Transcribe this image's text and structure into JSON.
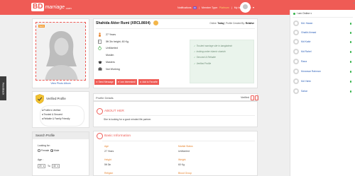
{
  "header": {
    "logo_main": "BD",
    "logo_script": "marriage",
    "logo_suffix": ".com",
    "notifications_label": "Notifications",
    "notifications_count": "16",
    "member_type_label": "Member Type:",
    "member_type_value": "Platinum",
    "separator": "|",
    "my_account": "My bdmarriage",
    "avatar_caret": "▾",
    "colors": {
      "brand": "#ef5b55",
      "badge": "#7b52c7",
      "platinum": "#f7d36a"
    }
  },
  "feedback_tab": "Feedback",
  "photo": {
    "ribbon": "NEW",
    "view_album": "View Photo Album"
  },
  "verified_profile": {
    "title": "Verified Profile",
    "items": [
      "Profile is Verified",
      "Trusted & Secured",
      "Reliable & Family Friendly"
    ]
  },
  "search": {
    "title": "Search Profile",
    "looking_for_label": "Looking for:",
    "options": [
      "Female",
      "Male"
    ],
    "selected_option": "Male",
    "age_label": "Age :",
    "age_from": "20",
    "age_to_label": "To",
    "age_to": "40"
  },
  "profile": {
    "name": "Shahida Akter Rumi (XRCL8604)",
    "online_prefix": "Online:",
    "online_value": "Today",
    "created_prefix": "| Profile Created By:",
    "created_value": "Relative",
    "attributes": [
      {
        "icon": "person-icon",
        "text": "27 Years"
      },
      {
        "icon": "height-icon",
        "text": "5ft 3in height, 60 Kg"
      },
      {
        "icon": "ring-icon",
        "text": "UnMarried"
      },
      {
        "icon": "religion-icon",
        "text": "Muslim"
      },
      {
        "icon": "graduation-icon",
        "text": "Masters"
      },
      {
        "icon": "briefcase-icon",
        "text": "Not Working"
      }
    ],
    "trust_points": [
      "Trusted marriage site in bangladesh",
      "looking under islamic shariah",
      "Secured & Reliable",
      "Verified Profile"
    ],
    "actions": [
      {
        "icon": "mail-icon",
        "label": "Send Message"
      },
      {
        "icon": "heart-icon",
        "label": "I am Interested!"
      },
      {
        "icon": "star-icon",
        "label": "Add to Favorite"
      }
    ]
  },
  "details": {
    "header": "Profile Details",
    "verified_label": "Verified",
    "about": {
      "title": "ABOUT HER",
      "text": "She is looking for a good minded life partner."
    },
    "basic": {
      "title": "Basic Information",
      "fields": [
        {
          "label": "Age",
          "value": "27 Years"
        },
        {
          "label": "Marital Status",
          "value": "UnMarried"
        },
        {
          "label": "Height",
          "value": "5ft 3in"
        },
        {
          "label": "Weight",
          "value": "60 Kg"
        },
        {
          "label": "Religion",
          "value": ""
        },
        {
          "label": "Blood Group",
          "value": ""
        }
      ]
    }
  },
  "online_panel": {
    "title": "I am Online",
    "caret": "▾",
    "users": [
      "Md. Hasan",
      "Ghalib Ahmad",
      "Md Kabir",
      "Md Rahel",
      "Rana",
      "Monowar Rahman",
      "Md Yahin",
      "Sahar"
    ]
  },
  "scroll_up": "▲"
}
